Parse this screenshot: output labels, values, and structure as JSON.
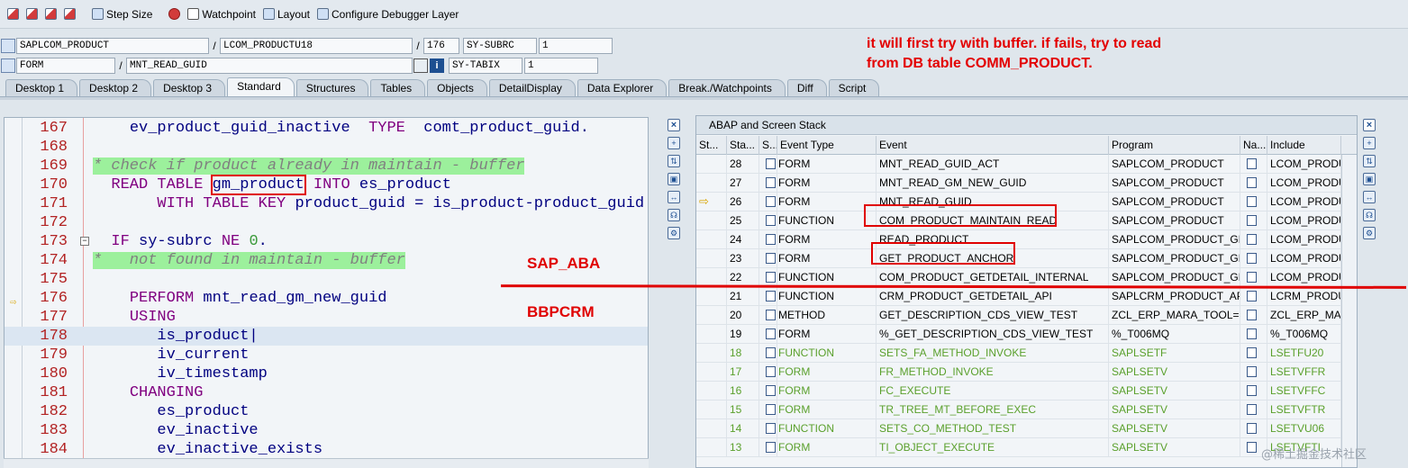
{
  "toolbar": {
    "step_size": "Step Size",
    "watchpoint": "Watchpoint",
    "layout": "Layout",
    "configure": "Configure Debugger Layer"
  },
  "fields": {
    "program": "SAPLCOM_PRODUCT",
    "include": "LCOM_PRODUCTU18",
    "line": "176",
    "var1_name": "SY-SUBRC",
    "var1_value": "1",
    "event_type": "FORM",
    "event": "MNT_READ_GUID",
    "var2_name": "SY-TABIX",
    "var2_value": "1"
  },
  "note": {
    "line1": "it will first try with buffer. if fails, try to read",
    "line2": "from DB table COMM_PRODUCT."
  },
  "tabs": [
    "Desktop 1",
    "Desktop 2",
    "Desktop 3",
    "Standard",
    "Structures",
    "Tables",
    "Objects",
    "DetailDisplay",
    "Data Explorer",
    "Break./Watchpoints",
    "Diff",
    "Script"
  ],
  "code": [
    {
      "no": "167",
      "html": "    <span class='src-t'>ev_product_guid_inactive</span>  <span class='kw'>TYPE</span>  comt_product_guid."
    },
    {
      "no": "168",
      "html": ""
    },
    {
      "no": "169",
      "html": "<span class='cmt'>* check if product already in maintain - buffer</span>"
    },
    {
      "no": "170",
      "html": "  <span class='kw'>READ TABLE</span> <span class='box'>gm_product</span> <span class='kw'>INTO</span> es_product"
    },
    {
      "no": "171",
      "html": "       <span class='kw'>WITH TABLE KEY</span> product_guid = is_product-product_guid"
    },
    {
      "no": "172",
      "html": ""
    },
    {
      "no": "173",
      "html": "  <span class='kw'>IF</span> sy-subrc <span class='kw'>NE</span> <span class='num'>0</span>."
    },
    {
      "no": "174",
      "html": "<span class='cmt'>*   not found in maintain - buffer</span>"
    },
    {
      "no": "175",
      "html": ""
    },
    {
      "no": "176",
      "html": "    <span class='kw'>PERFORM</span> mnt_read_gm_new_guid"
    },
    {
      "no": "177",
      "html": "    <span class='kw'>USING</span>"
    },
    {
      "no": "178",
      "html": "       is_product|"
    },
    {
      "no": "179",
      "html": "       iv_current"
    },
    {
      "no": "180",
      "html": "       iv_timestamp"
    },
    {
      "no": "181",
      "html": "    <span class='kw'>CHANGING</span>"
    },
    {
      "no": "182",
      "html": "       es_product"
    },
    {
      "no": "183",
      "html": "       ev_inactive"
    },
    {
      "no": "184",
      "html": "       ev_inactive_exists"
    }
  ],
  "stack": {
    "title": "ABAP and Screen Stack",
    "headers": [
      "St...",
      "Sta...",
      "S...",
      "Event Type",
      "Event",
      "Program",
      "Na...",
      "Include"
    ],
    "rows": [
      {
        "level": "28",
        "type": "FORM",
        "event": "MNT_READ_GUID_ACT",
        "program": "SAPLCOM_PRODUCT",
        "include": "LCOM_PRODU",
        "green": false
      },
      {
        "level": "27",
        "type": "FORM",
        "event": "MNT_READ_GM_NEW_GUID",
        "program": "SAPLCOM_PRODUCT",
        "include": "LCOM_PRODU",
        "green": false
      },
      {
        "level": "26",
        "type": "FORM",
        "event": "MNT_READ_GUID",
        "program": "SAPLCOM_PRODUCT",
        "include": "LCOM_PRODU",
        "green": false,
        "current": true
      },
      {
        "level": "25",
        "type": "FUNCTION",
        "event": "COM_PRODUCT_MAINTAIN_READ",
        "program": "SAPLCOM_PRODUCT",
        "include": "LCOM_PRODU",
        "green": false
      },
      {
        "level": "24",
        "type": "FORM",
        "event": "READ_PRODUCT",
        "program": "SAPLCOM_PRODUCT_GE...",
        "include": "LCOM_PRODU",
        "green": false
      },
      {
        "level": "23",
        "type": "FORM",
        "event": "GET_PRODUCT_ANCHOR",
        "program": "SAPLCOM_PRODUCT_GE...",
        "include": "LCOM_PRODU",
        "green": false
      },
      {
        "level": "22",
        "type": "FUNCTION",
        "event": "COM_PRODUCT_GETDETAIL_INTERNAL",
        "program": "SAPLCOM_PRODUCT_GE...",
        "include": "LCOM_PRODU",
        "green": false
      },
      {
        "level": "21",
        "type": "FUNCTION",
        "event": "CRM_PRODUCT_GETDETAIL_API",
        "program": "SAPLCRM_PRODUCT_API",
        "include": "LCRM_PRODU",
        "green": false
      },
      {
        "level": "20",
        "type": "METHOD",
        "event": "GET_DESCRIPTION_CDS_VIEW_TEST",
        "program": "ZCL_ERP_MARA_TOOL=...",
        "include": "ZCL_ERP_MAR",
        "green": false
      },
      {
        "level": "19",
        "type": "FORM",
        "event": "%_GET_DESCRIPTION_CDS_VIEW_TEST",
        "program": "%_T006MQ",
        "include": "%_T006MQ",
        "green": false
      },
      {
        "level": "18",
        "type": "FUNCTION",
        "event": "SETS_FA_METHOD_INVOKE",
        "program": "SAPLSETF",
        "include": "LSETFU20",
        "green": true
      },
      {
        "level": "17",
        "type": "FORM",
        "event": "FR_METHOD_INVOKE",
        "program": "SAPLSETV",
        "include": "LSETVFFR",
        "green": true
      },
      {
        "level": "16",
        "type": "FORM",
        "event": "FC_EXECUTE",
        "program": "SAPLSETV",
        "include": "LSETVFFC",
        "green": true
      },
      {
        "level": "15",
        "type": "FORM",
        "event": "TR_TREE_MT_BEFORE_EXEC",
        "program": "SAPLSETV",
        "include": "LSETVFTR",
        "green": true
      },
      {
        "level": "14",
        "type": "FUNCTION",
        "event": "SETS_CO_METHOD_TEST",
        "program": "SAPLSETV",
        "include": "LSETVU06",
        "green": true
      },
      {
        "level": "13",
        "type": "FORM",
        "event": "TI_OBJECT_EXECUTE",
        "program": "SAPLSETV",
        "include": "LSETVFTI",
        "green": true
      }
    ]
  },
  "annotations": {
    "upper_label": "SAP_ABA",
    "lower_label": "BBPCRM"
  },
  "watermark": "@稀土掘金技术社区",
  "colors": {
    "accent_red": "#e00000",
    "keyword": "#800080",
    "comment_bg": "#9cf09c",
    "line_number": "#b22222",
    "green_rows": "#5aa02c"
  }
}
